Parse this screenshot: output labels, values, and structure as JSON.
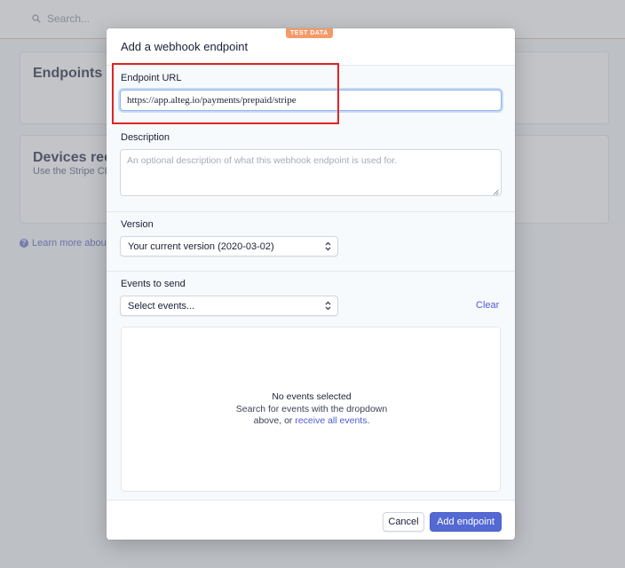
{
  "background": {
    "search_placeholder": "Search...",
    "endpoints_title": "Endpoints",
    "devices_title": "Devices rec",
    "devices_subtitle": "Use the Stripe CL",
    "learn_more": "Learn more about"
  },
  "modal": {
    "title": "Add a webhook endpoint",
    "test_badge": "TEST DATA",
    "endpoint_url": {
      "label": "Endpoint URL",
      "value": "https://app.alteg.io/payments/prepaid/stripe"
    },
    "description": {
      "label": "Description",
      "placeholder": "An optional description of what this webhook endpoint is used for."
    },
    "version": {
      "label": "Version",
      "selected": "Your current version (2020-03-02)"
    },
    "events": {
      "label": "Events to send",
      "select_placeholder": "Select events...",
      "clear_label": "Clear",
      "empty_title": "No events selected",
      "empty_line1": "Search for events with the dropdown",
      "empty_line2_prefix": "above, or ",
      "empty_link": "receive all events",
      "empty_line2_suffix": "."
    },
    "footer": {
      "cancel_label": "Cancel",
      "submit_label": "Add endpoint"
    }
  },
  "colors": {
    "primary": "#5469d4",
    "badge": "#f39b69",
    "highlight": "#e02424",
    "link": "#4f5bd5"
  },
  "icons": [
    "search-icon",
    "select-arrows-icon",
    "help-icon",
    "resize-grip-icon"
  ]
}
